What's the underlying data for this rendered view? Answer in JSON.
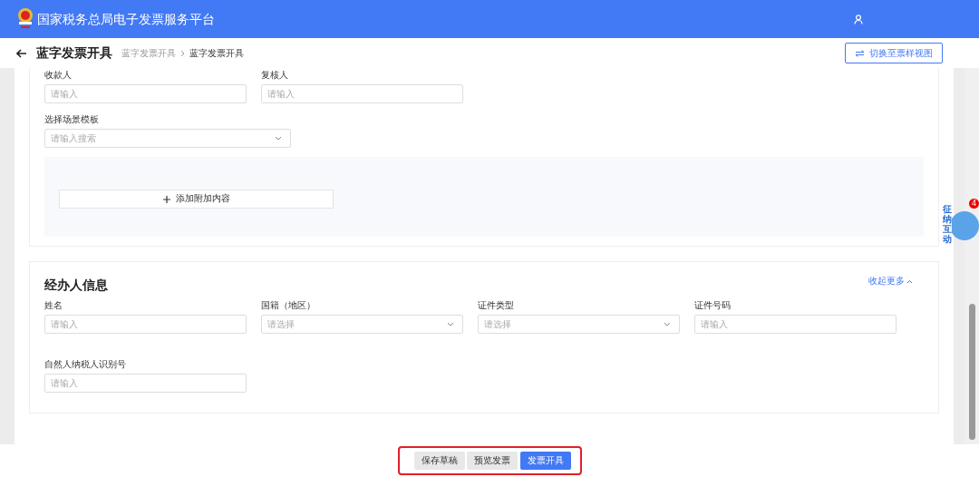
{
  "header": {
    "title": "国家税务总局电子发票服务平台"
  },
  "page": {
    "title": "蓝字发票开具",
    "breadcrumb": [
      {
        "label": "蓝字发票开具",
        "selected": false
      },
      {
        "label": "蓝字发票开具",
        "selected": true
      }
    ],
    "switch_button": "切换至票样视图"
  },
  "additional_section": {
    "fields": [
      {
        "label": "收款人",
        "placeholder": "请输入",
        "kind": "input"
      },
      {
        "label": "复核人",
        "placeholder": "请输入",
        "kind": "input"
      }
    ],
    "template": {
      "label": "选择场景模板",
      "placeholder": "请输入搜索",
      "kind": "select"
    },
    "add_button": "添加附加内容"
  },
  "agent_section": {
    "title": "经办人信息",
    "toggle": "收起更多",
    "expanded": true,
    "fields": [
      {
        "label": "姓名",
        "placeholder": "请输入",
        "kind": "input"
      },
      {
        "label": "国籍（地区）",
        "placeholder": "请选择",
        "kind": "select"
      },
      {
        "label": "证件类型",
        "placeholder": "请选择",
        "kind": "select"
      },
      {
        "label": "证件号码",
        "placeholder": "请输入",
        "kind": "input"
      },
      {
        "label": "自然人纳税人识别号",
        "placeholder": "请输入",
        "kind": "input"
      }
    ]
  },
  "float_widget": {
    "label": "征纳互动",
    "badge": "4"
  },
  "footer": {
    "buttons": [
      {
        "label": "保存草稿",
        "kind": "secondary"
      },
      {
        "label": "预览发票",
        "kind": "secondary"
      },
      {
        "label": "发票开具",
        "kind": "primary"
      }
    ]
  }
}
